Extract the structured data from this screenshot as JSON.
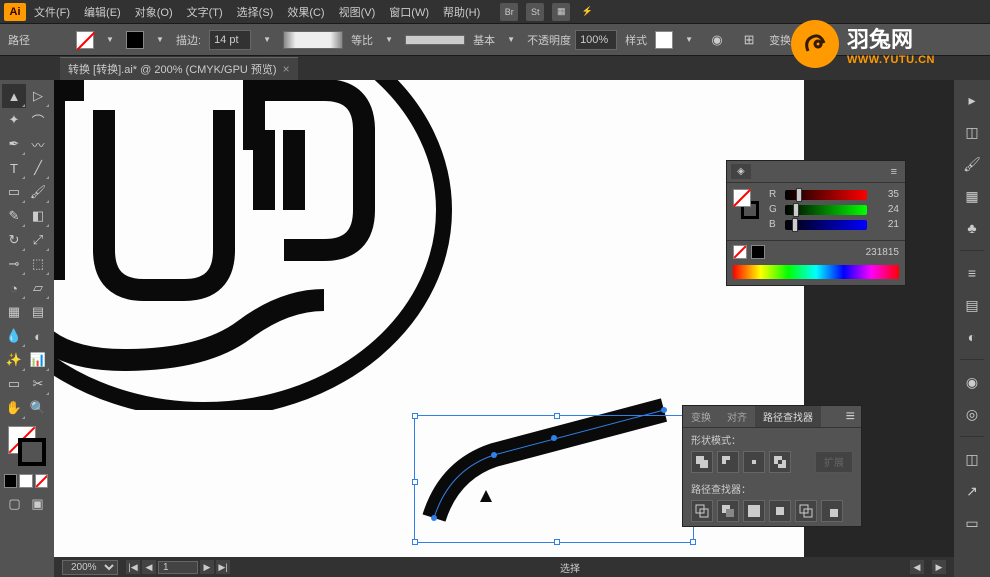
{
  "app": {
    "logo_text": "Ai"
  },
  "menu": {
    "file": "文件(F)",
    "edit": "编辑(E)",
    "object": "对象(O)",
    "type": "文字(T)",
    "select": "选择(S)",
    "effect": "效果(C)",
    "view": "视图(V)",
    "window": "窗口(W)",
    "help": "帮助(H)",
    "br_icon": "Br",
    "st_icon": "St"
  },
  "controlbar": {
    "label": "路径",
    "stroke_label": "描边:",
    "stroke_weight": "14 pt",
    "profile_label": "等比",
    "brush_label": "基本",
    "opacity_label": "不透明度",
    "opacity_value": "100%",
    "style_label": "样式",
    "transform_label": "变换"
  },
  "tabs": {
    "doc_title": "转换  [转换].ai* @ 200% (CMYK/GPU 预览)"
  },
  "color_panel": {
    "tab_label": "",
    "sliders": [
      {
        "label": "R",
        "value": "35",
        "pos": 14
      },
      {
        "label": "G",
        "value": "24",
        "pos": 10
      },
      {
        "label": "B",
        "value": "21",
        "pos": 9
      }
    ],
    "hex": "231815"
  },
  "pathfinder": {
    "tab_transform": "变换",
    "tab_align": "对齐",
    "tab_pathfinder": "路径查找器",
    "shape_modes": "形状模式：",
    "pathfinders": "路径查找器：",
    "expand": "扩展"
  },
  "statusbar": {
    "zoom": "200%",
    "page": "1",
    "status": "选择"
  },
  "watermark": {
    "title": "羽兔网",
    "url": "WWW.YUTU.CN"
  },
  "tools": [
    "selection",
    "direct-selection",
    "magic-wand",
    "lasso",
    "pen",
    "curvature",
    "type",
    "line",
    "rectangle",
    "paintbrush",
    "shaper",
    "eraser",
    "rotate",
    "scale",
    "width",
    "free-transform",
    "shape-builder",
    "perspective",
    "mesh",
    "gradient",
    "eyedropper",
    "blend",
    "symbol-sprayer",
    "column-graph",
    "artboard",
    "slice",
    "hand",
    "zoom"
  ]
}
